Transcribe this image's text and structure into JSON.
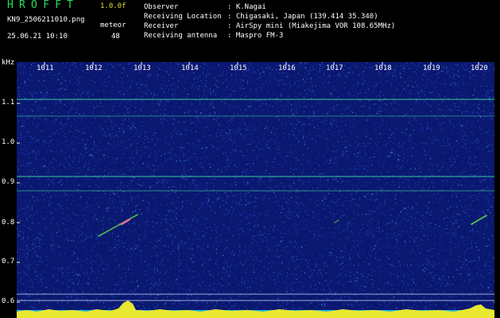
{
  "header": {
    "logo": "HROFFT",
    "version": "1.0.0f",
    "filename": "KN9_2506211010.png",
    "mode": "meteor",
    "datetime": "25.06.21 10:10",
    "gain": "48",
    "info": [
      {
        "label": "Observer",
        "value": ": K.Nagai"
      },
      {
        "label": "Receiving Location",
        "value": ": Chigasaki, Japan (139.414 35.340)"
      },
      {
        "label": "Receiver",
        "value": ": AirSpy mini (Miakejima VOR 108.65MHz)"
      },
      {
        "label": "Receiving antenna",
        "value": ": Maspro FM-3"
      }
    ]
  },
  "spectrogram": {
    "freq_unit": "kHz",
    "y_ticks": [
      "1.1",
      "1.0",
      "0.9",
      "0.8",
      "0.7",
      "0.6"
    ],
    "x_ticks": [
      "1011",
      "1012",
      "1013",
      "1014",
      "1015",
      "1016",
      "1017",
      "1018",
      "1019",
      "1020"
    ],
    "colors": {
      "background": "#0a1870",
      "carrier": "#38d8a0",
      "meteor": "#60e040",
      "bottom_noise": "#e8e830",
      "floor": "#20b8e0"
    }
  }
}
